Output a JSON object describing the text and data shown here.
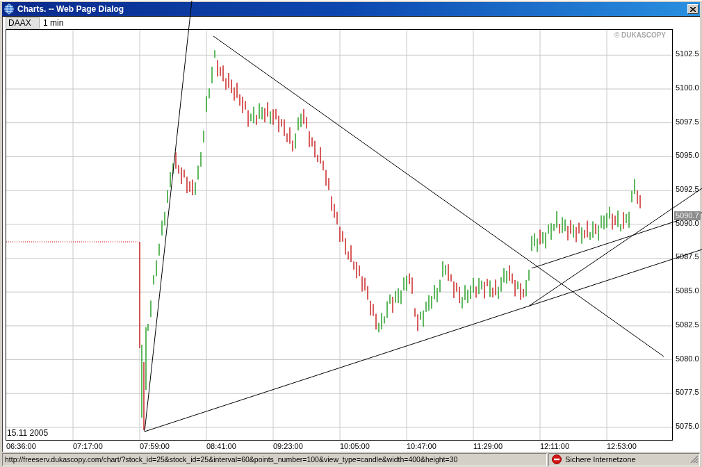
{
  "window": {
    "title": "Charts. -- Web Page Dialog"
  },
  "toolbar": {
    "symbol": "DAAX",
    "interval": "1 min"
  },
  "chart": {
    "copyright": "© DUKASCOPY",
    "date": "15.11 2005",
    "price_axis": [
      "5102.5",
      "5100.0",
      "5097.5",
      "5095.0",
      "5092.5",
      "5090.0",
      "5087.5",
      "5085.0",
      "5082.5",
      "5080.0",
      "5077.5",
      "5075.0"
    ],
    "current_price": "5090.7",
    "time_axis": [
      "06:36:00",
      "07:17:00",
      "07:59:00",
      "08:41:00",
      "09:23:00",
      "10:05:00",
      "10:47:00",
      "11:29:00",
      "12:11:00",
      "12:53:00"
    ]
  },
  "status_bar": {
    "url": "http://freeserv.dukascopy.com/chart/?stock_id=25&stock_id=25&interval=60&points_number=100&view_type=candle&width=400&height=30",
    "zone": "Sichere Internetzone"
  }
}
